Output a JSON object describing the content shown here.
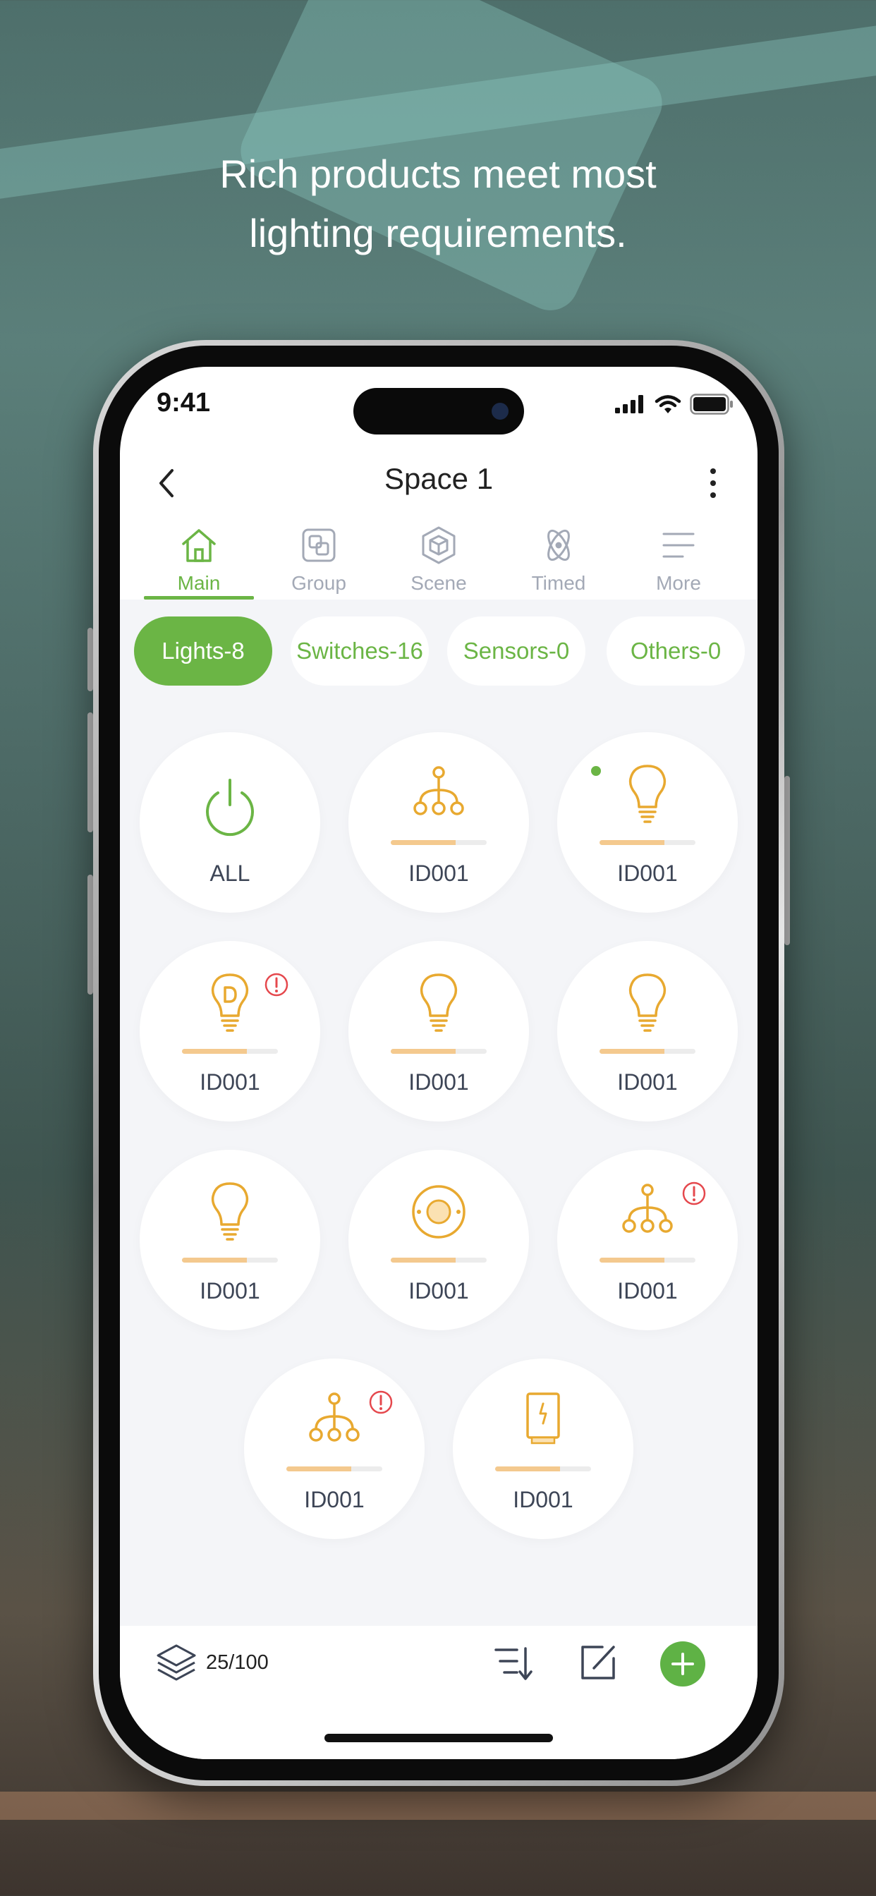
{
  "headline": {
    "line1": "Rich products meet most",
    "line2": "lighting requirements."
  },
  "status_bar": {
    "time": "9:41"
  },
  "nav": {
    "title": "Space 1"
  },
  "tabs": [
    {
      "label": "Main",
      "active": true,
      "icon": "home-icon"
    },
    {
      "label": "Group",
      "active": false,
      "icon": "group-icon"
    },
    {
      "label": "Scene",
      "active": false,
      "icon": "scene-icon"
    },
    {
      "label": "Timed",
      "active": false,
      "icon": "timed-icon"
    },
    {
      "label": "More",
      "active": false,
      "icon": "menu-icon"
    }
  ],
  "filters": [
    {
      "label": "Lights-8",
      "active": true
    },
    {
      "label": "Switches-16",
      "active": false
    },
    {
      "label": "Sensors-0",
      "active": false
    },
    {
      "label": "Others-0",
      "active": false
    }
  ],
  "devices": [
    {
      "label": "ALL",
      "icon": "power-icon",
      "level": null,
      "alert": false,
      "online": false
    },
    {
      "label": "ID001",
      "icon": "group-node-icon",
      "level": 0.68,
      "alert": false,
      "online": false
    },
    {
      "label": "ID001",
      "icon": "bulb-icon",
      "level": 0.68,
      "alert": false,
      "online": true
    },
    {
      "label": "ID001",
      "icon": "dimmable-bulb-icon",
      "level": 0.68,
      "alert": true,
      "online": false
    },
    {
      "label": "ID001",
      "icon": "bulb-icon",
      "level": 0.68,
      "alert": false,
      "online": false
    },
    {
      "label": "ID001",
      "icon": "bulb-icon",
      "level": 0.68,
      "alert": false,
      "online": false
    },
    {
      "label": "ID001",
      "icon": "bulb-icon",
      "level": 0.68,
      "alert": false,
      "online": false
    },
    {
      "label": "ID001",
      "icon": "ceiling-light-icon",
      "level": 0.68,
      "alert": false,
      "online": false
    },
    {
      "label": "ID001",
      "icon": "group-node-icon",
      "level": 0.68,
      "alert": true,
      "online": false
    },
    {
      "label": "ID001",
      "icon": "group-node-icon",
      "level": 0.68,
      "alert": true,
      "online": false
    },
    {
      "label": "ID001",
      "icon": "panel-light-icon",
      "level": 0.68,
      "alert": false,
      "online": false
    }
  ],
  "bottom_bar": {
    "count": "25/100"
  },
  "colors": {
    "accent": "#6bb545",
    "device": "#e8a930",
    "alert": "#e5484d",
    "bar_fill": "#f4c98e"
  }
}
